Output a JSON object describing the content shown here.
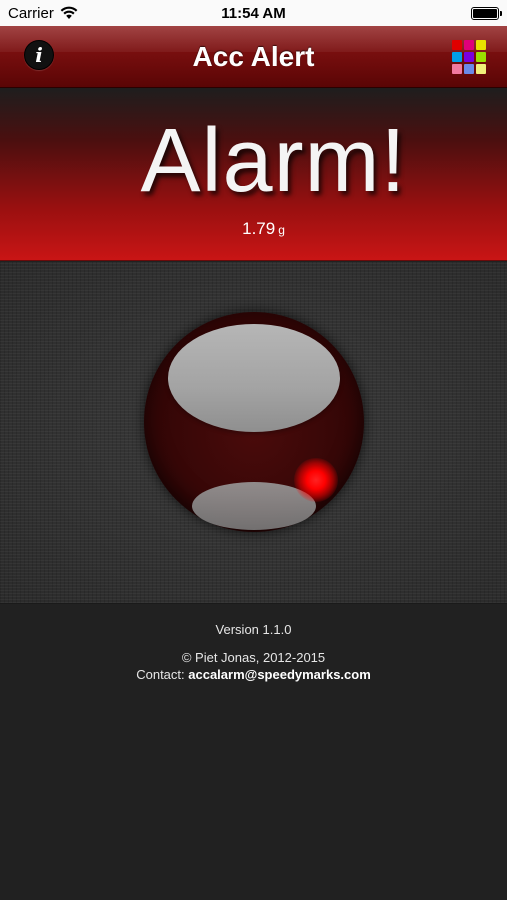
{
  "status_bar": {
    "carrier": "Carrier",
    "time": "11:54 AM"
  },
  "nav": {
    "title": "Acc Alert",
    "info_label": "i",
    "color_grid": [
      "#e00000",
      "#e0007a",
      "#e8e000",
      "#00a0e8",
      "#7a00e0",
      "#9ae000",
      "#f07aa0",
      "#6a8ae8",
      "#f0f07a"
    ]
  },
  "alarm": {
    "title": "Alarm!",
    "value": "1.79",
    "unit": "g",
    "led_color": "#ff0000"
  },
  "footer": {
    "version": "Version 1.1.0",
    "copyright": "© Piet Jonas, 2012-2015",
    "contact_label": "Contact:",
    "contact_email": "accalarm@speedymarks.com"
  },
  "icons": {
    "status_wifi": "wifi-icon",
    "status_battery": "battery-icon",
    "nav_info": "info-icon",
    "nav_colors": "color-grid-icon"
  }
}
